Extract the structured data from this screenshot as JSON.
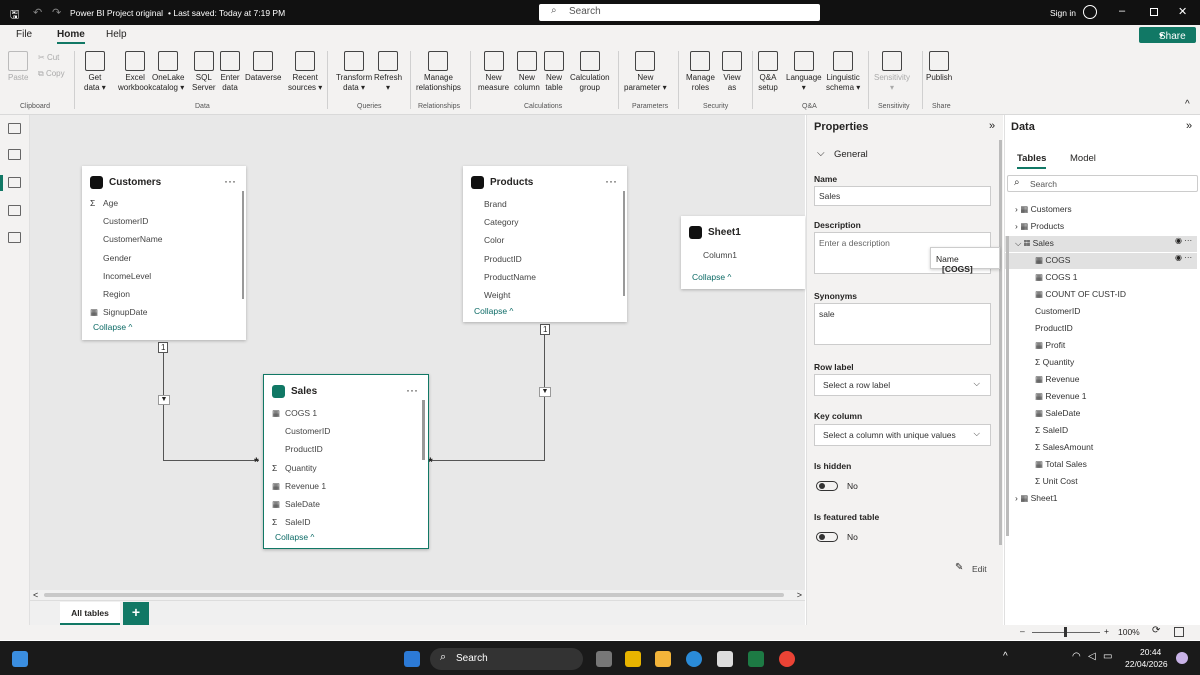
{
  "titlebar": {
    "title": "Power BI Project original",
    "saved": "• Last saved: Today at 7:19 PM",
    "search_placeholder": "Search",
    "sign_in": "Sign in"
  },
  "menu": {
    "file": "File",
    "home": "Home",
    "help": "Help",
    "share": "Share"
  },
  "ribbon": {
    "clipboard": {
      "paste": "Paste",
      "cut": "Cut",
      "copy": "Copy",
      "group": "Clipboard"
    },
    "data_buttons": [
      {
        "l1": "Get",
        "l2": "data ▾"
      },
      {
        "l1": "Excel",
        "l2": "workbook"
      },
      {
        "l1": "OneLake",
        "l2": "catalog ▾"
      },
      {
        "l1": "SQL",
        "l2": "Server"
      },
      {
        "l1": "Enter",
        "l2": "data"
      },
      {
        "l1": "Dataverse",
        "l2": ""
      },
      {
        "l1": "Recent",
        "l2": "sources ▾"
      }
    ],
    "data_group": "Data",
    "queries_buttons": [
      {
        "l1": "Transform",
        "l2": "data ▾"
      },
      {
        "l1": "Refresh",
        "l2": "▾"
      }
    ],
    "queries_group": "Queries",
    "rel_buttons": [
      {
        "l1": "Manage",
        "l2": "relationships"
      }
    ],
    "rel_group": "Relationships",
    "calc_buttons": [
      {
        "l1": "New",
        "l2": "measure"
      },
      {
        "l1": "New",
        "l2": "column"
      },
      {
        "l1": "New",
        "l2": "table"
      },
      {
        "l1": "Calculation",
        "l2": "group"
      }
    ],
    "calc_group": "Calculations",
    "param_buttons": [
      {
        "l1": "New",
        "l2": "parameter ▾"
      }
    ],
    "param_group": "Parameters",
    "sec_buttons": [
      {
        "l1": "Manage",
        "l2": "roles"
      },
      {
        "l1": "View",
        "l2": "as"
      }
    ],
    "sec_group": "Security",
    "qa_buttons": [
      {
        "l1": "Q&A",
        "l2": "setup"
      },
      {
        "l1": "Language",
        "l2": "▾"
      },
      {
        "l1": "Linguistic",
        "l2": "schema ▾"
      }
    ],
    "qa_group": "Q&A",
    "sens_buttons": [
      {
        "l1": "Sensitivity",
        "l2": "▾"
      }
    ],
    "sens_group": "Sensitivity",
    "share_buttons": [
      {
        "l1": "Publish",
        "l2": ""
      }
    ],
    "share_group": "Share"
  },
  "tables": {
    "customers": {
      "title": "Customers",
      "fields": [
        "Age",
        "CustomerID",
        "CustomerName",
        "Gender",
        "IncomeLevel",
        "Region",
        "SignupDate"
      ],
      "collapse": "Collapse ^"
    },
    "products": {
      "title": "Products",
      "fields": [
        "Brand",
        "Category",
        "Color",
        "ProductID",
        "ProductName",
        "Weight"
      ],
      "collapse": "Collapse ^"
    },
    "sheet1": {
      "title": "Sheet1",
      "fields": [
        "Column1"
      ],
      "collapse": "Collapse ^"
    },
    "sales": {
      "title": "Sales",
      "fields": [
        "COGS 1",
        "CustomerID",
        "ProductID",
        "Quantity",
        "Revenue 1",
        "SaleDate",
        "SaleID"
      ],
      "collapse": "Collapse ^"
    }
  },
  "relations": {
    "one": "1",
    "many": "*"
  },
  "tabs": {
    "all": "All tables",
    "add": "+"
  },
  "properties": {
    "title": "Properties",
    "section": "General",
    "name_label": "Name",
    "name_value": "Sales",
    "desc_label": "Description",
    "desc_placeholder": "Enter a description",
    "syn_label": "Synonyms",
    "syn_value": "sale",
    "row_label": "Row label",
    "row_select": "Select a row label",
    "key_label": "Key column",
    "key_select": "Select a column with unique values",
    "hidden_label": "Is hidden",
    "hidden_value": "No",
    "featured_label": "Is featured table",
    "featured_value": "No",
    "edit": "Edit"
  },
  "tooltip": {
    "label": "Name",
    "value": "[COGS]"
  },
  "data": {
    "title": "Data",
    "tab_tables": "Tables",
    "tab_model": "Model",
    "search_placeholder": "Search",
    "tree": [
      "Customers",
      "Products",
      "Sales"
    ],
    "sales_fields": [
      "COGS",
      "COGS 1",
      "COUNT OF CUST-ID",
      "CustomerID",
      "ProductID",
      "Profit",
      "Quantity",
      "Revenue",
      "Revenue 1",
      "SaleDate",
      "SaleID",
      "SalesAmount",
      "Total Sales",
      "Unit Cost"
    ],
    "sheet": "Sheet1"
  },
  "status": {
    "zoom": "100%",
    "minus": "–",
    "plus": "+"
  },
  "taskbar": {
    "search": "Search",
    "time": "20:44",
    "date": "22/04/2026"
  }
}
